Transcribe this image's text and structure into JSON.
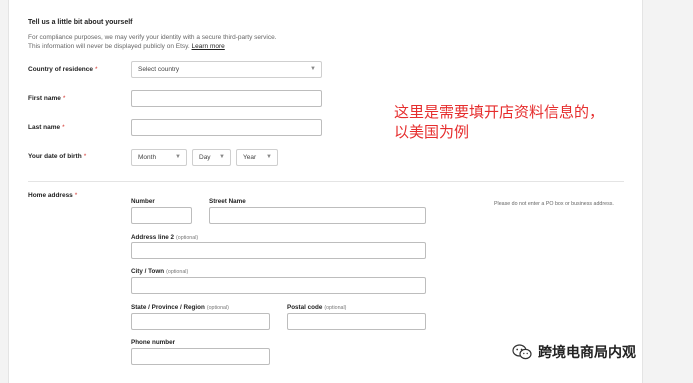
{
  "header": {
    "title": "Tell us a little bit about yourself",
    "desc_line1": "For compliance purposes, we may verify your identity with a secure third-party service.",
    "desc_line2": "This information will never be displayed publicly on Etsy.",
    "learn_more": "Learn more"
  },
  "fields": {
    "country_label": "Country of residence",
    "country_placeholder": "Select country",
    "first_name_label": "First name",
    "last_name_label": "Last name",
    "dob_label": "Your date of birth",
    "month": "Month",
    "day": "Day",
    "year": "Year",
    "required_mark": "*"
  },
  "address": {
    "label": "Home address",
    "number": "Number",
    "street": "Street Name",
    "line2": "Address line 2",
    "city": "City / Town",
    "state": "State / Province / Region",
    "postal": "Postal code",
    "phone": "Phone number",
    "optional": "(optional)",
    "hint": "Please do not enter a PO box or business address."
  },
  "annotation": {
    "text": "这里是需要填开店资料信息的，以美国为例"
  },
  "watermark": {
    "text": "跨境电商局内观"
  },
  "colors": {
    "required": "#d4332c",
    "annotation": "#e62e2e"
  }
}
